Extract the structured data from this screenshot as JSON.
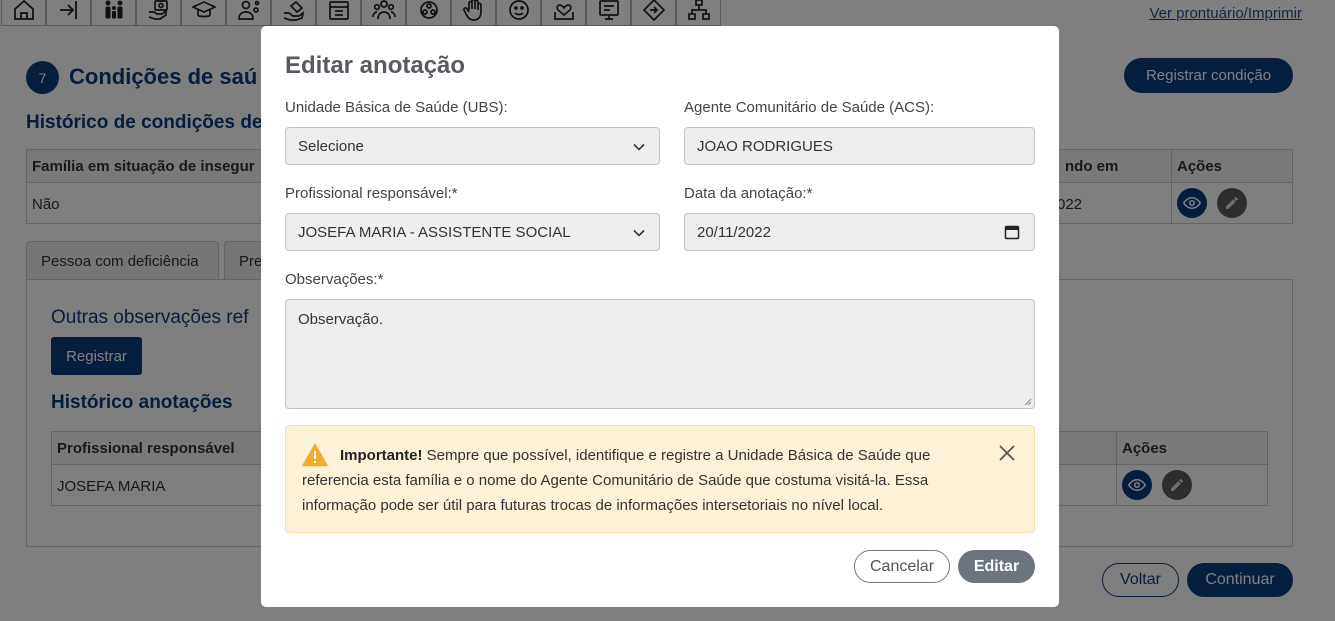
{
  "topbar": {
    "link_label": "Ver prontuário/Imprimir",
    "icons": [
      "home-icon",
      "login-icon",
      "family-icon",
      "hand-money-icon",
      "graduation-cap-icon",
      "person-gears-icon",
      "hand-heart-icon",
      "cash-register-icon",
      "people-group-icon",
      "puzzle-people-icon",
      "raised-hand-icon",
      "smile-face-icon",
      "heart-hands-icon",
      "certificate-icon",
      "diamond-sign-icon",
      "org-chart-icon"
    ]
  },
  "section": {
    "number": "7",
    "title": "Condições de saú",
    "register_button": "Registrar condição",
    "history_title": "Histórico de condições de",
    "table": {
      "col1": "Família em situação de insegur",
      "col2": "ndo em",
      "col3": "Ações",
      "row_col1": "Não",
      "row_col2": "022"
    },
    "tabs": [
      "Pessoa com deficiência",
      "Pre"
    ],
    "panel": {
      "outras_title": "Outras observações ref",
      "register_label": "Registrar",
      "history_title": "Histórico anotações",
      "table": {
        "col1": "Profissional responsável",
        "col3": "Ações",
        "row_col1": "JOSEFA MARIA"
      }
    },
    "back_label": "Voltar",
    "continue_label": "Continuar"
  },
  "modal": {
    "title": "Editar anotação",
    "ubs_label": "Unidade Básica de Saúde (UBS):",
    "ubs_value": "Selecione",
    "acs_label": "Agente Comunitário de Saúde (ACS):",
    "acs_value": "JOAO RODRIGUES",
    "prof_label": "Profissional responsável:*",
    "prof_value": "JOSEFA MARIA - ASSISTENTE SOCIAL",
    "date_label": "Data da anotação:*",
    "date_value": "20/11/2022",
    "obs_label": "Observações:*",
    "obs_value": "Observação.",
    "alert_strong": "Importante!",
    "alert_text": " Sempre que possível, identifique e registre a Unidade Básica de Saúde que referencia esta família e o nome do Agente Comunitário de Saúde que costuma visitá-la. Essa informação pode ser útil para futuras trocas de informações intersetoriais no nível local.",
    "cancel_label": "Cancelar",
    "edit_label": "Editar"
  },
  "colors": {
    "primary": "#0d3d7d",
    "overlay": "rgba(0,0,0,0.5)",
    "alert_bg": "#fdf1d8",
    "warning": "#f0ad2c",
    "edit_button": "#6c757d"
  }
}
